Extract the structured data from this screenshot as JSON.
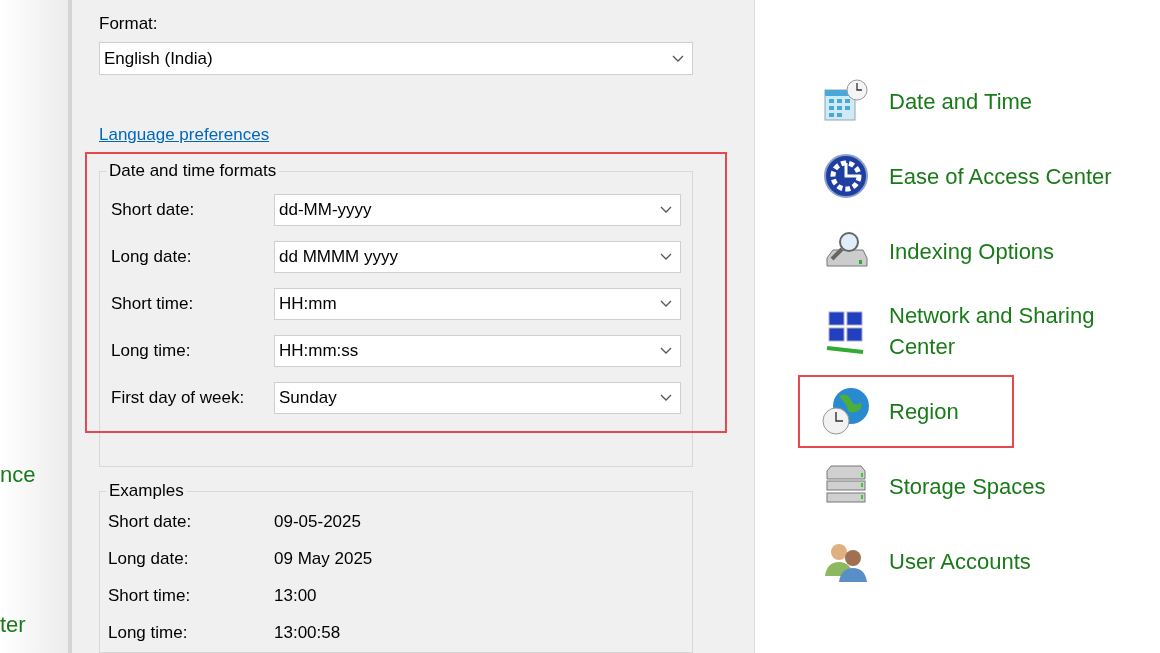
{
  "background_items": [
    {
      "label": "nce"
    },
    {
      "label": "ter"
    }
  ],
  "dialog": {
    "format": {
      "label": "Format:",
      "value": "English (India)"
    },
    "language_link": "Language preferences",
    "formats_group": {
      "title": "Date and time formats",
      "highlighted": true,
      "rows": [
        {
          "label": "Short date:",
          "value": "dd-MM-yyyy"
        },
        {
          "label": "Long date:",
          "value": "dd MMMM yyyy"
        },
        {
          "label": "Short time:",
          "value": "HH:mm"
        },
        {
          "label": "Long time:",
          "value": "HH:mm:ss"
        },
        {
          "label": "First day of week:",
          "value": "Sunday"
        }
      ]
    },
    "examples_group": {
      "title": "Examples",
      "rows": [
        {
          "label": "Short date:",
          "value": "09-05-2025"
        },
        {
          "label": "Long date:",
          "value": "09 May 2025"
        },
        {
          "label": "Short time:",
          "value": "13:00"
        },
        {
          "label": "Long time:",
          "value": "13:00:58"
        }
      ]
    }
  },
  "control_panel_items": [
    {
      "kind": "datetime",
      "label": "Date and Time",
      "highlighted": false
    },
    {
      "kind": "access",
      "label": "Ease of Access Center",
      "highlighted": false
    },
    {
      "kind": "indexing",
      "label": "Indexing Options",
      "highlighted": false
    },
    {
      "kind": "network",
      "label": "Network and Sharing Center",
      "highlighted": false
    },
    {
      "kind": "region",
      "label": "Region",
      "highlighted": true
    },
    {
      "kind": "storage",
      "label": "Storage Spaces",
      "highlighted": false
    },
    {
      "kind": "users",
      "label": "User Accounts",
      "highlighted": false
    }
  ]
}
